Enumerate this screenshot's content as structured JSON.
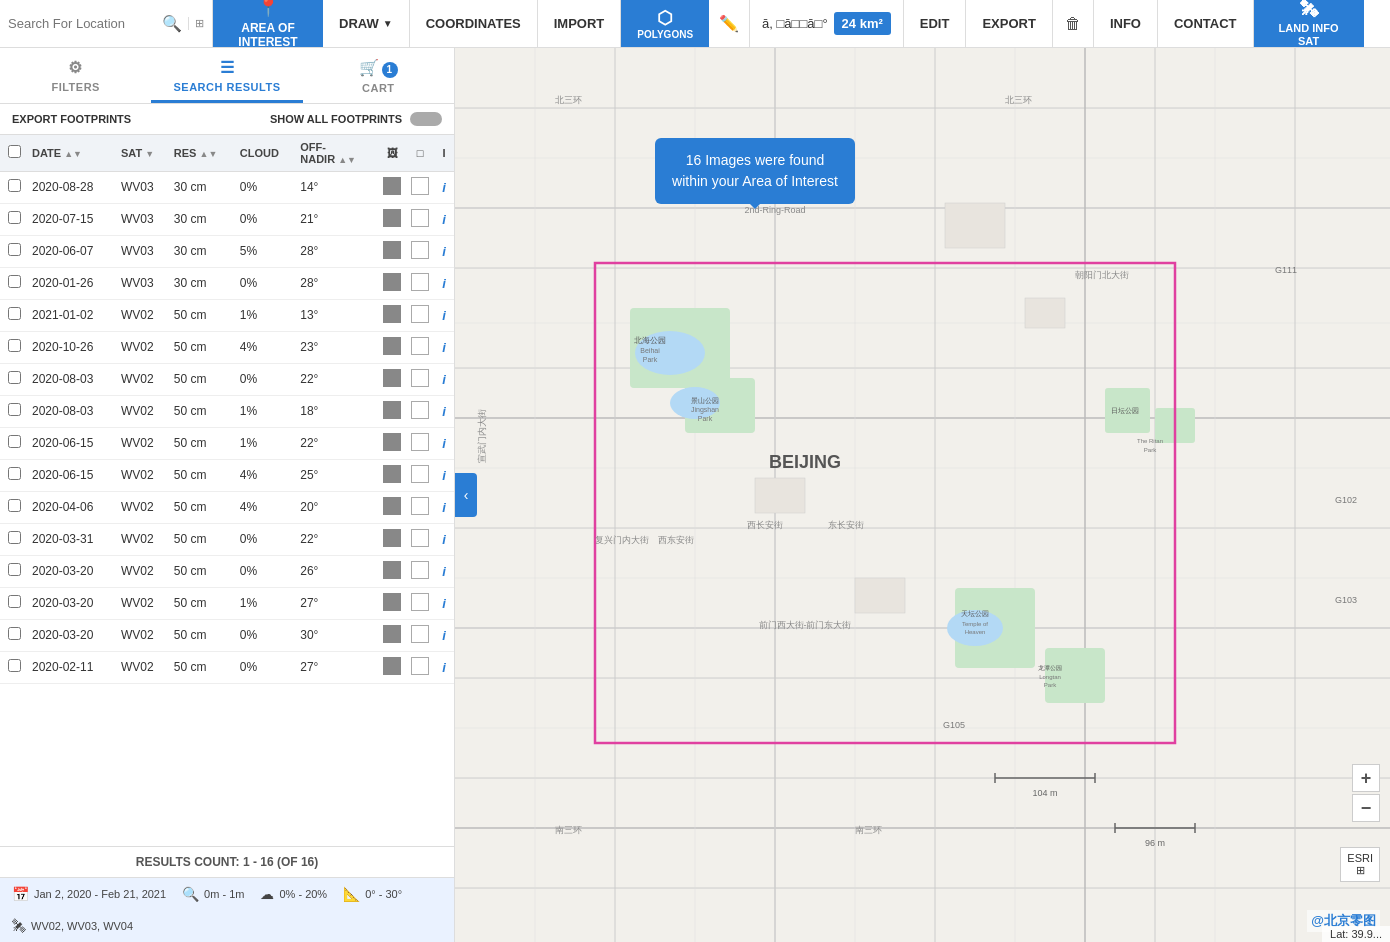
{
  "nav": {
    "search_placeholder": "Search For Location",
    "area_interest": "AREA OF\nINTEREST",
    "draw": "DRAW",
    "coordinates": "COORDINATES",
    "import": "IMPORT",
    "polygons": "POLYGONS",
    "edit": "EDIT",
    "export": "EXPORT",
    "delete": "🗑",
    "info": "INFO",
    "contact": "CONTACT",
    "land_info_sat": "LAND INFO\nSAT",
    "coord_value": "ā, □ā□□ā□°",
    "area_value": "24 km²"
  },
  "tabs": {
    "filters": "FILTERS",
    "search_results": "SEARCH RESULTS",
    "cart": "CART",
    "cart_badge": "1"
  },
  "table": {
    "export_footprints": "EXPORT FOOTPRINTS",
    "show_all_footprints": "SHOW ALL FOOTPRINTS",
    "columns": [
      "",
      "DATE",
      "SAT",
      "RES",
      "CLOUD",
      "OFF-\nNADIR",
      "",
      "",
      "i"
    ],
    "rows": [
      {
        "date": "2020-08-28",
        "sat": "WV03",
        "res": "30 cm",
        "cloud": "0%",
        "off_nadir": "14°"
      },
      {
        "date": "2020-07-15",
        "sat": "WV03",
        "res": "30 cm",
        "cloud": "0%",
        "off_nadir": "21°"
      },
      {
        "date": "2020-06-07",
        "sat": "WV03",
        "res": "30 cm",
        "cloud": "5%",
        "off_nadir": "28°"
      },
      {
        "date": "2020-01-26",
        "sat": "WV03",
        "res": "30 cm",
        "cloud": "0%",
        "off_nadir": "28°"
      },
      {
        "date": "2021-01-02",
        "sat": "WV02",
        "res": "50 cm",
        "cloud": "1%",
        "off_nadir": "13°"
      },
      {
        "date": "2020-10-26",
        "sat": "WV02",
        "res": "50 cm",
        "cloud": "4%",
        "off_nadir": "23°"
      },
      {
        "date": "2020-08-03",
        "sat": "WV02",
        "res": "50 cm",
        "cloud": "0%",
        "off_nadir": "22°"
      },
      {
        "date": "2020-08-03",
        "sat": "WV02",
        "res": "50 cm",
        "cloud": "1%",
        "off_nadir": "18°"
      },
      {
        "date": "2020-06-15",
        "sat": "WV02",
        "res": "50 cm",
        "cloud": "1%",
        "off_nadir": "22°"
      },
      {
        "date": "2020-06-15",
        "sat": "WV02",
        "res": "50 cm",
        "cloud": "4%",
        "off_nadir": "25°"
      },
      {
        "date": "2020-04-06",
        "sat": "WV02",
        "res": "50 cm",
        "cloud": "4%",
        "off_nadir": "20°"
      },
      {
        "date": "2020-03-31",
        "sat": "WV02",
        "res": "50 cm",
        "cloud": "0%",
        "off_nadir": "22°"
      },
      {
        "date": "2020-03-20",
        "sat": "WV02",
        "res": "50 cm",
        "cloud": "0%",
        "off_nadir": "26°"
      },
      {
        "date": "2020-03-20",
        "sat": "WV02",
        "res": "50 cm",
        "cloud": "1%",
        "off_nadir": "27°"
      },
      {
        "date": "2020-03-20",
        "sat": "WV02",
        "res": "50 cm",
        "cloud": "0%",
        "off_nadir": "30°"
      },
      {
        "date": "2020-02-11",
        "sat": "WV02",
        "res": "50 cm",
        "cloud": "0%",
        "off_nadir": "27°"
      }
    ],
    "results_count": "RESULTS COUNT:",
    "results_range": "1 - 16 (of 16)"
  },
  "filter_bar": {
    "date_range": "Jan 2, 2020 - Feb 21, 2021",
    "resolution": "0m - 1m",
    "cloud": "0% - 20%",
    "off_nadir": "0° - 30°",
    "satellites": "WV02, WV03, WV04"
  },
  "map": {
    "tooltip": "16 Images were found\nwithin your Area of Interest",
    "zoom_in": "+",
    "zoom_out": "−",
    "esri": "ESRI",
    "layers_icon": "⊞",
    "watermark": "@北京零图",
    "lat_lon": "Lat: 39.9..."
  }
}
